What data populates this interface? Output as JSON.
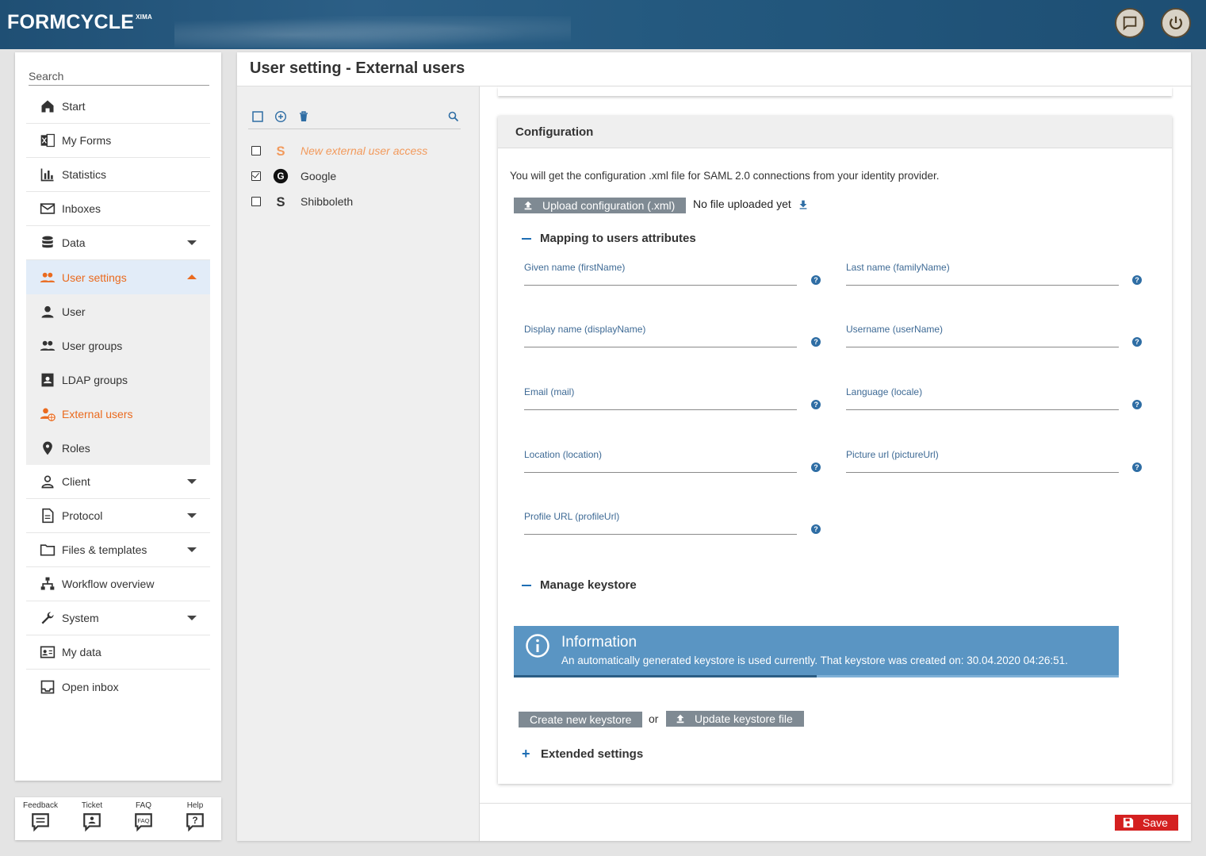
{
  "header": {
    "logo": "FORMCYCLE",
    "logo_sup": "XIMA"
  },
  "sidebar": {
    "search_placeholder": "Search",
    "items": [
      {
        "label": "Start"
      },
      {
        "label": "My Forms"
      },
      {
        "label": "Statistics"
      },
      {
        "label": "Inboxes"
      },
      {
        "label": "Data"
      },
      {
        "label": "User settings"
      },
      {
        "label": "User"
      },
      {
        "label": "User groups"
      },
      {
        "label": "LDAP groups"
      },
      {
        "label": "External users"
      },
      {
        "label": "Roles"
      },
      {
        "label": "Client"
      },
      {
        "label": "Protocol"
      },
      {
        "label": "Files & templates"
      },
      {
        "label": "Workflow overview"
      },
      {
        "label": "System"
      },
      {
        "label": "My data"
      },
      {
        "label": "Open inbox"
      }
    ],
    "tools": [
      "Feedback",
      "Ticket",
      "FAQ",
      "Help"
    ]
  },
  "page": {
    "title": "User setting - External users"
  },
  "list": {
    "rows": [
      {
        "label": "New external user access",
        "checked": false
      },
      {
        "label": "Google",
        "checked": true
      },
      {
        "label": "Shibboleth",
        "checked": false
      }
    ]
  },
  "config": {
    "heading": "Configuration",
    "intro": "You will get the configuration .xml file for SAML 2.0 connections from your identity provider.",
    "upload_label": "Upload configuration (.xml)",
    "no_file": "No file uploaded yet",
    "mapping_title": "Mapping to users attributes",
    "fields": [
      {
        "label": "Given name (firstName)"
      },
      {
        "label": "Last name (familyName)"
      },
      {
        "label": "Display name (displayName)"
      },
      {
        "label": "Username (userName)"
      },
      {
        "label": "Email (mail)"
      },
      {
        "label": "Language (locale)"
      },
      {
        "label": "Location (location)"
      },
      {
        "label": "Picture url (pictureUrl)"
      },
      {
        "label": "Profile URL (profileUrl)"
      }
    ],
    "keystore_title": "Manage keystore",
    "info_title": "Information",
    "info_text": "An automatically generated keystore is used currently. That keystore was created on: 30.04.2020 04:26:51.",
    "info_progress": 0.5,
    "create_keystore": "Create new keystore",
    "or": "or",
    "update_keystore": "Update keystore file",
    "extended_title": "Extended settings",
    "help_glyph": "?"
  },
  "footer": {
    "save_label": "Save"
  },
  "colors": {
    "accent": "#ea6a1e",
    "header": "#24597f",
    "info": "#5a95c3",
    "save": "#d42020"
  }
}
